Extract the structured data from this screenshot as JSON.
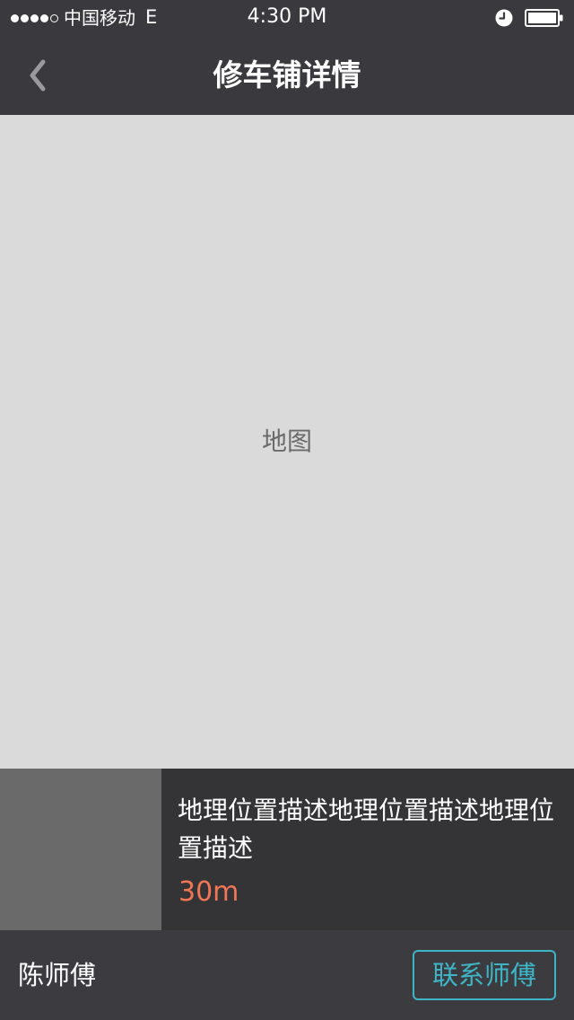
{
  "status_bar": {
    "signal_bars_filled": 4,
    "signal_bars_total": 5,
    "carrier": "中国移动",
    "network": "E",
    "time": "4:30 PM",
    "icons": [
      "clock-icon",
      "battery-icon"
    ],
    "battery_level": 1.0
  },
  "nav": {
    "back_icon": "chevron-left-icon",
    "title": "修车铺详情"
  },
  "map": {
    "placeholder": "地图"
  },
  "info": {
    "location_description": "地理位置描述地理位置描述地理位置描述",
    "distance": "30m"
  },
  "bottom": {
    "master_name": "陈师傅",
    "contact_label": "联系师傅"
  },
  "colors": {
    "bar_background": "#3a3a3e",
    "map_background": "#dadada",
    "thumbnail": "#6a6a6a",
    "distance": "#f07656",
    "accent": "#3eb5c6"
  }
}
